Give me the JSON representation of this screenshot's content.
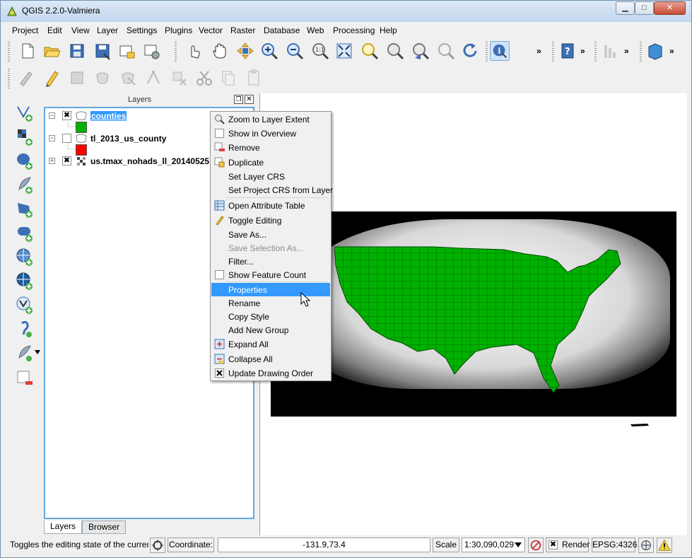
{
  "window": {
    "title": "QGIS 2.2.0-Valmiera",
    "buttons": {
      "minimize": "▁",
      "maximize": "□",
      "close": "✕"
    }
  },
  "menubar": [
    "Project",
    "Edit",
    "View",
    "Layer",
    "Settings",
    "Plugins",
    "Vector",
    "Raster",
    "Database",
    "Web",
    "Processing",
    "Help"
  ],
  "toolbar1": {
    "icons": [
      "new-project-icon",
      "open-project-icon",
      "save-project-icon",
      "save-as-icon",
      "new-print-composer-icon",
      "composer-manager-icon",
      "touch-zoom-icon",
      "pan-icon",
      "pan-to-selection-icon",
      "zoom-in-icon",
      "zoom-out-icon",
      "zoom-actual-size-icon",
      "zoom-full-icon",
      "zoom-to-selection-icon",
      "zoom-to-layer-icon",
      "zoom-last-icon",
      "zoom-next-icon",
      "refresh-icon",
      "identify-icon",
      "help-icon",
      "histogram-icon",
      "georeferencer-icon"
    ],
    "more": "»"
  },
  "toolbar2": {
    "icons": [
      "current-edits-icon",
      "toggle-editing-icon",
      "save-edits-icon",
      "add-feature-icon",
      "move-feature-icon",
      "node-tool-icon",
      "delete-selected-icon",
      "cut-features-icon",
      "copy-features-icon",
      "paste-features-icon"
    ]
  },
  "left_toolbar": [
    "add-vector-layer-icon",
    "add-raster-layer-icon",
    "add-postgis-layer-icon",
    "add-spatialite-layer-icon",
    "add-mssql-layer-icon",
    "add-oracle-layer-icon",
    "add-wms-layer-icon",
    "add-wcs-layer-icon",
    "add-wfs-layer-icon",
    "add-delimited-text-layer-icon",
    "new-shapefile-layer-icon",
    "remove-layer-icon"
  ],
  "layers_panel": {
    "title": "Layers",
    "layers": [
      {
        "name": "counties",
        "checked": "✖",
        "expander": "−",
        "swatch_color": "#00b000",
        "selected": true
      },
      {
        "name": "tl_2013_us_county",
        "checked": "",
        "expander": "−",
        "swatch_color": "#ff0000",
        "selected": false
      },
      {
        "name": "us.tmax_nohads_ll_20140525",
        "checked": "✖",
        "expander": "+",
        "selected": false
      }
    ],
    "tabs": [
      "Layers",
      "Browser"
    ]
  },
  "context_menu": {
    "items": [
      {
        "label": "Zoom to Layer Extent",
        "icon": "zoom-to-layer-icon",
        "state": "normal"
      },
      {
        "label": "Show in Overview",
        "icon": "checkbox-icon",
        "state": "normal"
      },
      {
        "label": "Remove",
        "icon": "remove-layer-icon",
        "state": "normal"
      },
      {
        "label": "Duplicate",
        "icon": "duplicate-layer-icon",
        "state": "normal"
      },
      {
        "label": "Set Layer CRS",
        "icon": "",
        "state": "normal"
      },
      {
        "label": "Set Project CRS from Layer",
        "icon": "",
        "state": "normal"
      },
      {
        "label": "Open Attribute Table",
        "icon": "attribute-table-icon",
        "state": "normal"
      },
      {
        "label": "Toggle Editing",
        "icon": "pencil-icon",
        "state": "normal"
      },
      {
        "label": "Save As...",
        "icon": "",
        "state": "normal"
      },
      {
        "label": "Save Selection As...",
        "icon": "",
        "state": "disabled"
      },
      {
        "label": "Filter...",
        "icon": "",
        "state": "normal"
      },
      {
        "label": "Show Feature Count",
        "icon": "checkbox-icon",
        "state": "normal"
      },
      {
        "label": "Properties",
        "icon": "",
        "state": "selected"
      },
      {
        "label": "Rename",
        "icon": "",
        "state": "normal"
      },
      {
        "label": "Copy Style",
        "icon": "",
        "state": "normal"
      },
      {
        "label": "Add New Group",
        "icon": "",
        "state": "normal"
      },
      {
        "label": "Expand All",
        "icon": "expand-all-icon",
        "state": "normal"
      },
      {
        "label": "Collapse All",
        "icon": "collapse-all-icon",
        "state": "normal"
      },
      {
        "label": "Update Drawing Order",
        "icon": "checked-checkbox-icon",
        "state": "normal"
      }
    ]
  },
  "statusbar": {
    "message": "Toggles the editing state of the current la",
    "coordinate_label": "Coordinate:",
    "coordinate_value": "-131.9,73.4",
    "scale_label": "Scale",
    "scale_value": "1:30,090,029",
    "render_label": "Render",
    "render_checked": "✖",
    "crs": "EPSG:4326"
  },
  "colors": {
    "selection": "#3399ff",
    "counties_fill": "#00b000",
    "county_outline": "#ff0000",
    "raster_background": "#000000"
  }
}
